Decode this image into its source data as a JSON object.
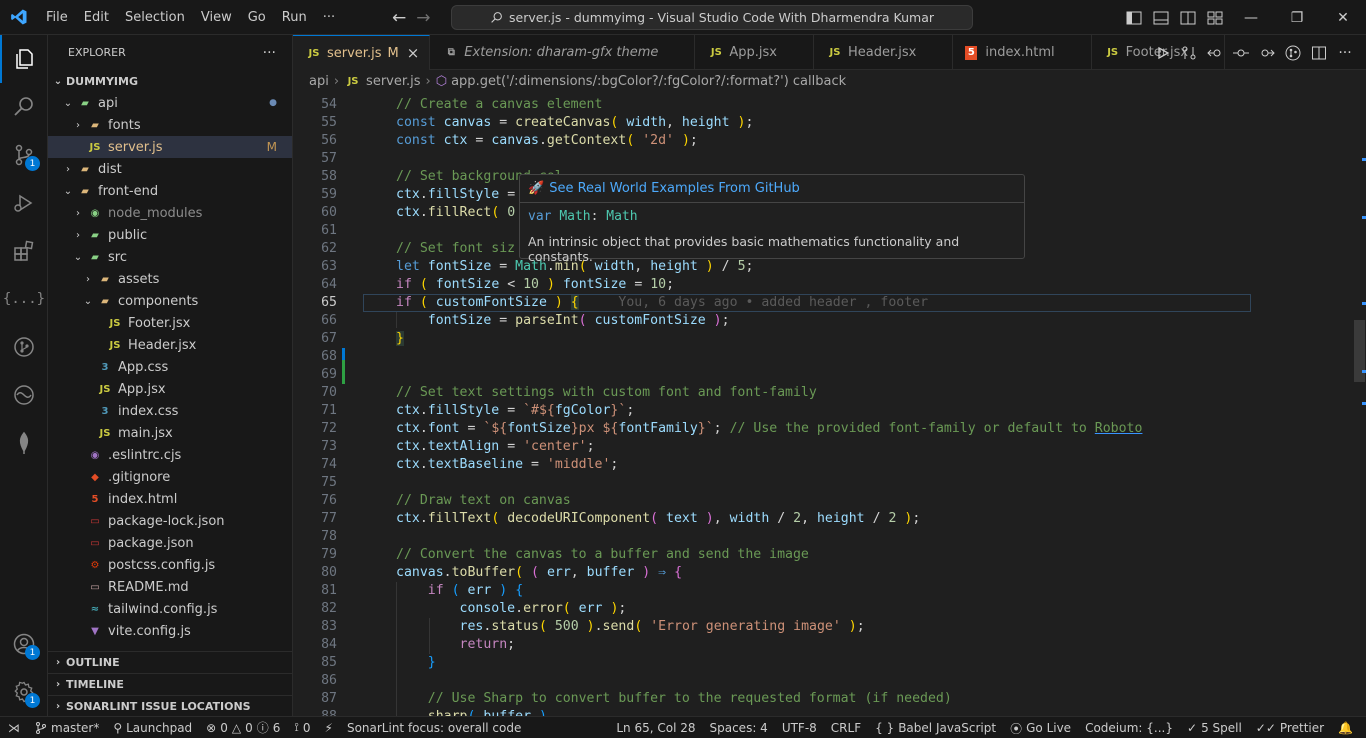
{
  "titlebar": {
    "menu": [
      "File",
      "Edit",
      "Selection",
      "View",
      "Go",
      "Run",
      "···"
    ],
    "search": "server.js - dummyimg - Visual Studio Code With Dharmendra Kumar"
  },
  "activity": {
    "source_control_badge": "1",
    "accounts_badge": "1",
    "settings_badge": "1"
  },
  "explorer": {
    "title": "EXPLORER",
    "project": "DUMMYIMG",
    "rows": [
      {
        "label": "api",
        "chev": "⌄",
        "depth": 1,
        "icon": "api",
        "color": "#89d185",
        "modified": "●"
      },
      {
        "label": "fonts",
        "chev": "›",
        "depth": 2,
        "icon": "folder",
        "color": "#dcb67a"
      },
      {
        "label": "server.js",
        "chev": "",
        "depth": 2,
        "icon": "js",
        "color": "#cbcb41",
        "modified": "M",
        "selected": true
      },
      {
        "label": "dist",
        "chev": "›",
        "depth": 1,
        "icon": "folder",
        "color": "#dcb67a"
      },
      {
        "label": "front-end",
        "chev": "⌄",
        "depth": 1,
        "icon": "folder",
        "color": "#dcb67a"
      },
      {
        "label": "node_modules",
        "chev": "›",
        "depth": 2,
        "icon": "node",
        "color": "#89d185",
        "dim": true
      },
      {
        "label": "public",
        "chev": "›",
        "depth": 2,
        "icon": "public",
        "color": "#89d185"
      },
      {
        "label": "src",
        "chev": "⌄",
        "depth": 2,
        "icon": "src",
        "color": "#89d185"
      },
      {
        "label": "assets",
        "chev": "›",
        "depth": 3,
        "icon": "folder",
        "color": "#dcb67a"
      },
      {
        "label": "components",
        "chev": "⌄",
        "depth": 3,
        "icon": "folder",
        "color": "#dcb67a"
      },
      {
        "label": "Footer.jsx",
        "chev": "",
        "depth": 4,
        "icon": "js",
        "color": "#cbcb41"
      },
      {
        "label": "Header.jsx",
        "chev": "",
        "depth": 4,
        "icon": "js",
        "color": "#cbcb41"
      },
      {
        "label": "App.css",
        "chev": "",
        "depth": 3,
        "icon": "css",
        "color": "#519aba"
      },
      {
        "label": "App.jsx",
        "chev": "",
        "depth": 3,
        "icon": "js",
        "color": "#cbcb41"
      },
      {
        "label": "index.css",
        "chev": "",
        "depth": 3,
        "icon": "css",
        "color": "#519aba"
      },
      {
        "label": "main.jsx",
        "chev": "",
        "depth": 3,
        "icon": "js",
        "color": "#cbcb41"
      },
      {
        "label": ".eslintrc.cjs",
        "chev": "",
        "depth": 2,
        "icon": "eslint",
        "color": "#a074c4"
      },
      {
        "label": ".gitignore",
        "chev": "",
        "depth": 2,
        "icon": "git",
        "color": "#e44d26"
      },
      {
        "label": "index.html",
        "chev": "",
        "depth": 2,
        "icon": "html",
        "color": "#e44d26"
      },
      {
        "label": "package-lock.json",
        "chev": "",
        "depth": 2,
        "icon": "npm",
        "color": "#cb3837"
      },
      {
        "label": "package.json",
        "chev": "",
        "depth": 2,
        "icon": "npm",
        "color": "#cb3837"
      },
      {
        "label": "postcss.config.js",
        "chev": "",
        "depth": 2,
        "icon": "postcss",
        "color": "#dd3a0a"
      },
      {
        "label": "README.md",
        "chev": "",
        "depth": 2,
        "icon": "md",
        "color": "#c5a3a3"
      },
      {
        "label": "tailwind.config.js",
        "chev": "",
        "depth": 2,
        "icon": "tailwind",
        "color": "#44a8b3"
      },
      {
        "label": "vite.config.js",
        "chev": "",
        "depth": 2,
        "icon": "vite",
        "color": "#a074c4"
      }
    ],
    "sections": [
      "OUTLINE",
      "TIMELINE",
      "SONARLINT ISSUE LOCATIONS"
    ]
  },
  "tabs": [
    {
      "label": "server.js",
      "icon": "js",
      "modified": "M",
      "active": true,
      "close": "×"
    },
    {
      "label": "Extension: dharam-gfx theme",
      "icon": "ext",
      "italic": true
    },
    {
      "label": "App.jsx",
      "icon": "js"
    },
    {
      "label": "Header.jsx",
      "icon": "js"
    },
    {
      "label": "index.html",
      "icon": "html"
    },
    {
      "label": "Footer.jsx",
      "icon": "js"
    }
  ],
  "breadcrumb": {
    "folder": "api",
    "file": "server.js",
    "symbol": "app.get('/:dimensions/:bgColor?/:fgColor?/:format?') callback"
  },
  "editor": {
    "current_line": "65",
    "lines": [
      {
        "n": "54",
        "html": "<span class='c'>// Create a canvas element</span>"
      },
      {
        "n": "55",
        "html": "<span class='k'>const</span> <span class='v'>canvas</span> = <span class='f'>createCanvas</span><span class='p'>(</span> <span class='v'>width</span>, <span class='v'>height</span> <span class='p'>)</span>;"
      },
      {
        "n": "56",
        "html": "<span class='k'>const</span> <span class='v'>ctx</span> = <span class='v'>canvas</span>.<span class='f'>getContext</span><span class='p'>(</span> <span class='s'>'2d'</span> <span class='p'>)</span>;"
      },
      {
        "n": "57",
        "html": ""
      },
      {
        "n": "58",
        "html": "<span class='c'>// Set background col</span>"
      },
      {
        "n": "59",
        "html": "<span class='v'>ctx</span>.<span class='v'>fillStyle</span> = "
      },
      {
        "n": "60",
        "html": "<span class='v'>ctx</span>.<span class='f'>fillRect</span><span class='p'>(</span> <span class='n'>0</span>"
      },
      {
        "n": "61",
        "html": ""
      },
      {
        "n": "62",
        "html": "<span class='c'>// Set font siz</span>"
      },
      {
        "n": "63",
        "html": "<span class='k'>let</span> <span class='v'>fontSize</span> = <span class='t'>Math</span>.<span class='f'>min</span><span class='p'>(</span> <span class='v'>width</span>, <span class='v'>height</span> <span class='p'>)</span> / <span class='n'>5</span>;"
      },
      {
        "n": "64",
        "html": "<span class='kc'>if</span> <span class='p'>(</span> <span class='v'>fontSize</span> &lt; <span class='n'>10</span> <span class='p'>)</span> <span class='v'>fontSize</span> = <span class='n'>10</span>;"
      },
      {
        "n": "65",
        "html": "<span class='kc'>if</span> <span class='p'>(</span> <span class='v'>customFontSize</span> <span class='p'>)</span> <span class='p bracketbg'>{</span>     <span class='inline-blame'>You, 6 days ago • added header , footer</span>"
      },
      {
        "n": "66",
        "html": "    <span class='v'>fontSize</span> = <span class='f'>parseInt</span><span class='p2'>(</span> <span class='v'>customFontSize</span> <span class='p2'>)</span>;"
      },
      {
        "n": "67",
        "html": "<span class='p bracketbg'>}</span>"
      },
      {
        "n": "68",
        "html": ""
      },
      {
        "n": "69",
        "html": ""
      },
      {
        "n": "70",
        "html": "<span class='c'>// Set text settings with custom font and font-family</span>"
      },
      {
        "n": "71",
        "html": "<span class='v'>ctx</span>.<span class='v'>fillStyle</span> = <span class='s'>`#${</span><span class='v'>fgColor</span><span class='s'>}`</span>;"
      },
      {
        "n": "72",
        "html": "<span class='v'>ctx</span>.<span class='v'>font</span> = <span class='s'>`${</span><span class='v'>fontSize</span><span class='s'>}px ${</span><span class='v'>fontFamily</span><span class='s'>}`</span>; <span class='c'>// Use the provided font-family or default to <u style='text-decoration-color:#3794ff'>Roboto</u></span>"
      },
      {
        "n": "73",
        "html": "<span class='v'>ctx</span>.<span class='v'>textAlign</span> = <span class='s'>'center'</span>;"
      },
      {
        "n": "74",
        "html": "<span class='v'>ctx</span>.<span class='v'>textBaseline</span> = <span class='s'>'middle'</span>;"
      },
      {
        "n": "75",
        "html": ""
      },
      {
        "n": "76",
        "html": "<span class='c'>// Draw text on canvas</span>"
      },
      {
        "n": "77",
        "html": "<span class='v'>ctx</span>.<span class='f'>fillText</span><span class='p'>(</span> <span class='f'>decodeURIComponent</span><span class='p2'>(</span> <span class='v'>text</span> <span class='p2'>)</span>, <span class='v'>width</span> / <span class='n'>2</span>, <span class='v'>height</span> / <span class='n'>2</span> <span class='p'>)</span>;"
      },
      {
        "n": "78",
        "html": ""
      },
      {
        "n": "79",
        "html": "<span class='c'>// Convert the canvas to a buffer and send the image</span>"
      },
      {
        "n": "80",
        "html": "<span class='v'>canvas</span>.<span class='f'>toBuffer</span><span class='p'>(</span> <span class='p2'>(</span> <span class='v'>err</span>, <span class='v'>buffer</span> <span class='p2'>)</span> <span class='k'>⇒</span> <span class='p2'>{</span>"
      },
      {
        "n": "81",
        "html": "    <span class='kc'>if</span> <span class='p3'>(</span> <span class='v'>err</span> <span class='p3'>)</span> <span class='p3'>{</span>"
      },
      {
        "n": "82",
        "html": "        <span class='v'>console</span>.<span class='f'>error</span><span class='p'>(</span> <span class='v'>err</span> <span class='p'>)</span>;"
      },
      {
        "n": "83",
        "html": "        <span class='v'>res</span>.<span class='f'>status</span><span class='p'>(</span> <span class='n'>500</span> <span class='p'>)</span>.<span class='f'>send</span><span class='p'>(</span> <span class='s'>'Error generating image'</span> <span class='p'>)</span>;"
      },
      {
        "n": "84",
        "html": "        <span class='kc'>return</span>;"
      },
      {
        "n": "85",
        "html": "    <span class='p3'>}</span>"
      },
      {
        "n": "86",
        "html": ""
      },
      {
        "n": "87",
        "html": "    <span class='c'>// Use Sharp to convert buffer to the requested format (if needed)</span>"
      },
      {
        "n": "88",
        "html": "    <span class='f'>sharp</span><span class='p3'>(</span> <span class='v'>buffer</span> <span class='p3'>)</span>"
      }
    ]
  },
  "hover": {
    "link": "See Real World Examples From GitHub",
    "sig_kw": "var",
    "sig_name": "Math",
    "sig_type": "Math",
    "doc": "An intrinsic object that provides basic mathematics functionality and constants."
  },
  "status": {
    "branch": "master*",
    "launchpad": "Launchpad",
    "errors": "0",
    "warnings": "0",
    "info": "6",
    "ports": "0",
    "sonar": "SonarLint focus: overall code",
    "position": "Ln 65, Col 28",
    "spaces": "Spaces: 4",
    "encoding": "UTF-8",
    "eol": "CRLF",
    "language": "Babel JavaScript",
    "golive": "Go Live",
    "codeium": "Codeium: {...}",
    "spell": "5 Spell",
    "prettier": "Prettier"
  }
}
